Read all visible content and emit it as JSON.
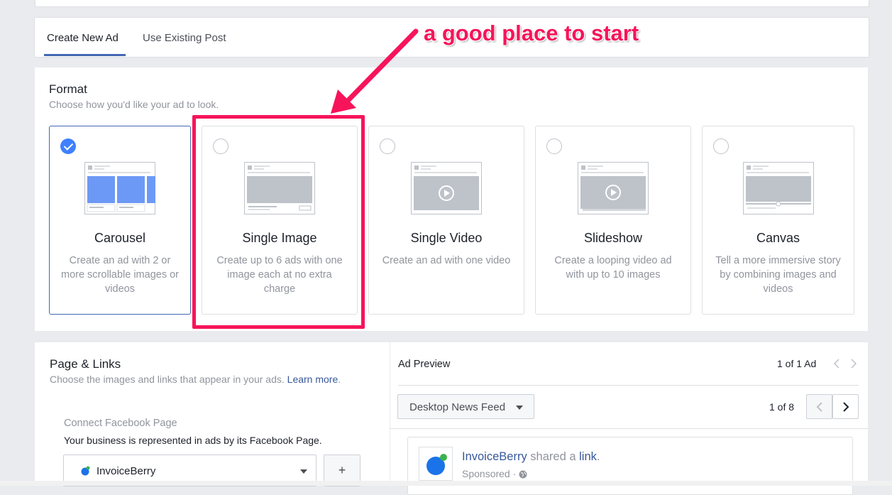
{
  "tabs": [
    {
      "label": "Create New Ad",
      "active": true
    },
    {
      "label": "Use Existing Post",
      "active": false
    }
  ],
  "annotation": {
    "text": "a good place to start",
    "color": "#f7145a"
  },
  "format": {
    "title": "Format",
    "subtitle": "Choose how you'd like your ad to look.",
    "options": [
      {
        "name": "Carousel",
        "description": "Create an ad with 2 or more scrollable images or videos",
        "selected": true,
        "icon": "carousel-preview-icon"
      },
      {
        "name": "Single Image",
        "description": "Create up to 6 ads with one image each at no extra charge",
        "selected": false,
        "icon": "single-image-preview-icon"
      },
      {
        "name": "Single Video",
        "description": "Create an ad with one video",
        "selected": false,
        "icon": "single-video-preview-icon"
      },
      {
        "name": "Slideshow",
        "description": "Create a looping video ad with up to 10 images",
        "selected": false,
        "icon": "slideshow-preview-icon"
      },
      {
        "name": "Canvas",
        "description": "Tell a more immersive story by combining images and videos",
        "selected": false,
        "icon": "canvas-preview-icon"
      }
    ]
  },
  "page_links": {
    "title": "Page & Links",
    "subtitle": "Choose the images and links that appear in your ads.",
    "learn_more": "Learn more",
    "period": ".",
    "connect_label": "Connect Facebook Page",
    "connect_desc": "Your business is represented in ads by its Facebook Page.",
    "page_select": "InvoiceBerry",
    "add_button": "+"
  },
  "preview": {
    "title": "Ad Preview",
    "ad_count": "1 of 1 Ad",
    "placement": "Desktop News Feed",
    "placement_count": "1 of 8",
    "post": {
      "page_name": "InvoiceBerry",
      "shared_text": "shared a",
      "link_text": "link",
      "period": ".",
      "sponsored": "Sponsored ·"
    }
  },
  "colors": {
    "accent": "#4267b2",
    "check": "#4080ff",
    "highlight": "#f7145a",
    "link": "#365899"
  }
}
